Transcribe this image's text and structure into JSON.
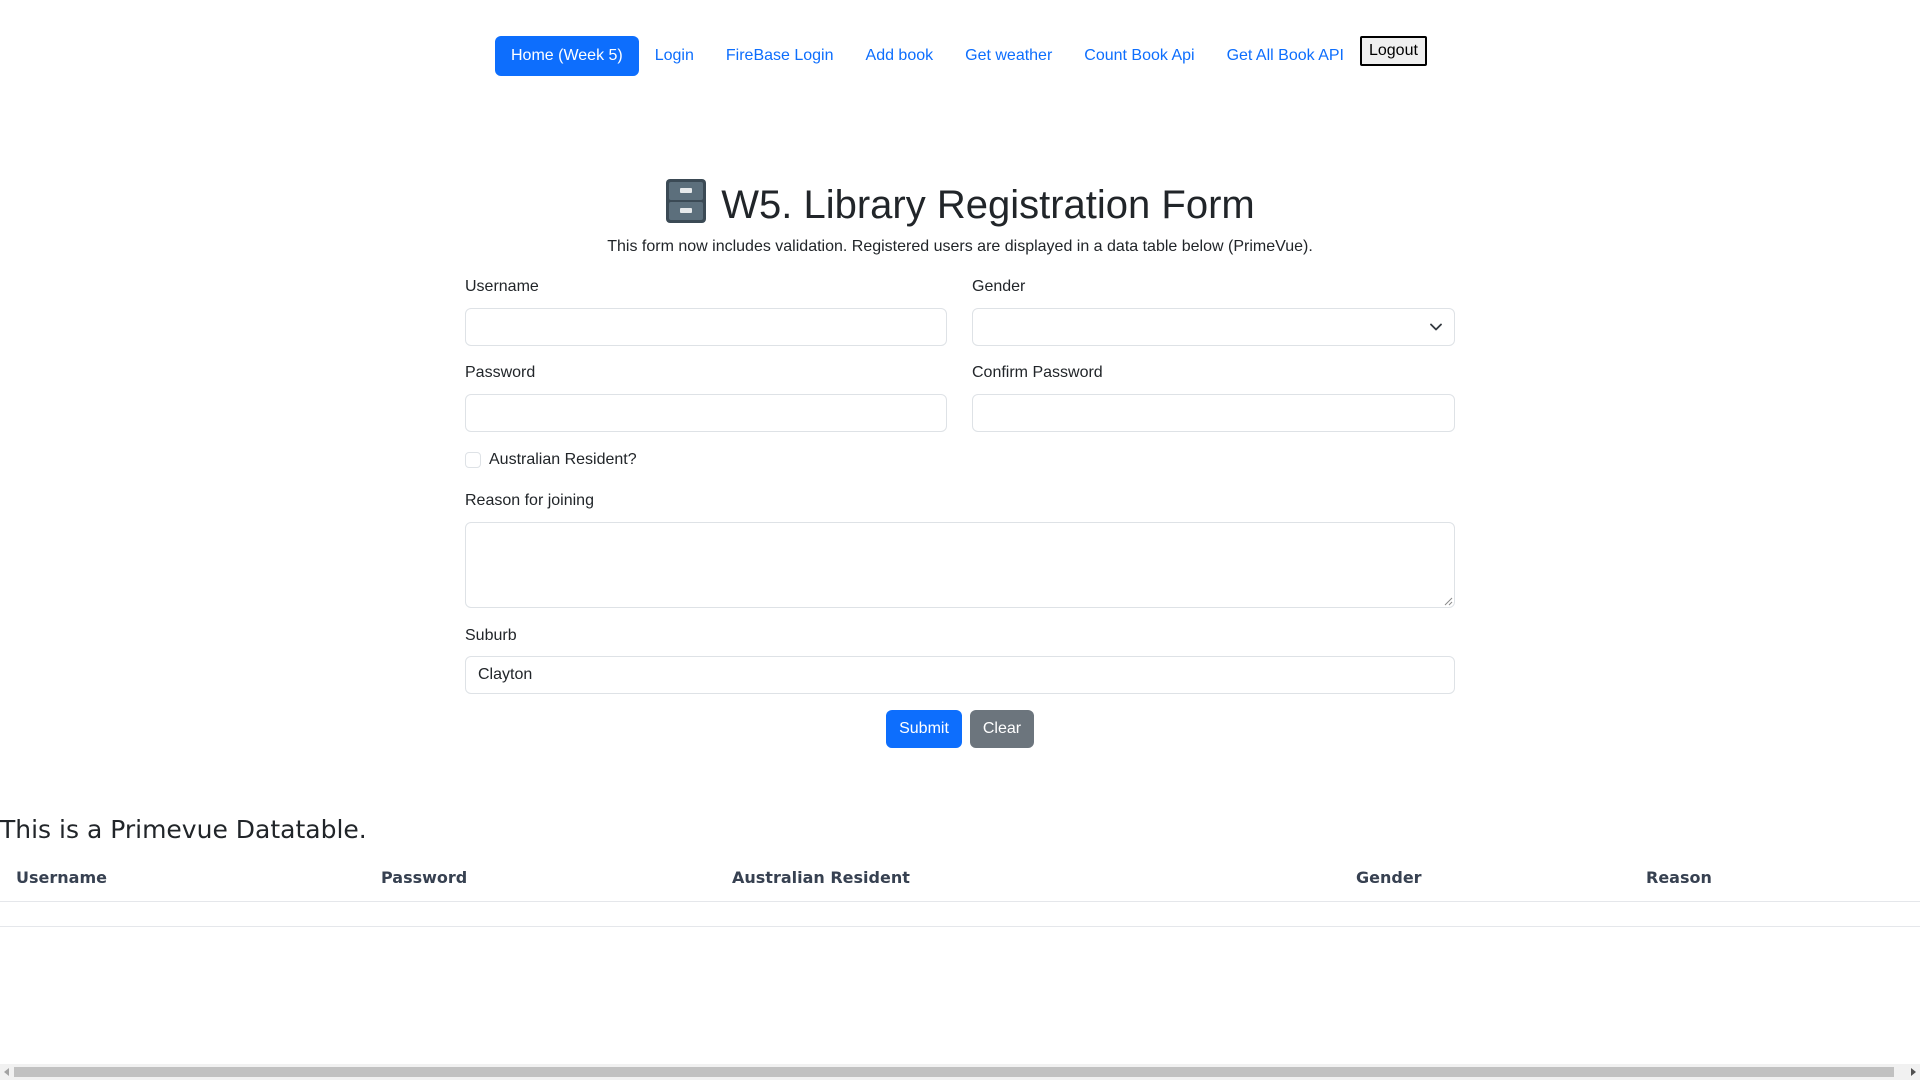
{
  "nav": {
    "items": [
      {
        "label": "Home (Week 5)"
      },
      {
        "label": "Login"
      },
      {
        "label": "FireBase Login"
      },
      {
        "label": "Add book"
      },
      {
        "label": "Get weather"
      },
      {
        "label": "Count Book Api"
      },
      {
        "label": "Get All Book API"
      }
    ],
    "logout_label": "Logout"
  },
  "form": {
    "title": "W5. Library Registration Form",
    "title_icon": "file-cabinet-icon",
    "subtitle": "This form now includes validation. Registered users are displayed in a data table below (PrimeVue).",
    "username_label": "Username",
    "username_value": "",
    "gender_label": "Gender",
    "gender_value": "",
    "password_label": "Password",
    "password_value": "",
    "confirm_password_label": "Confirm Password",
    "confirm_password_value": "",
    "resident_label": "Australian Resident?",
    "resident_checked": false,
    "reason_label": "Reason for joining",
    "reason_value": "",
    "suburb_label": "Suburb",
    "suburb_value": "Clayton",
    "submit_label": "Submit",
    "clear_label": "Clear"
  },
  "table": {
    "title": "This is a Primevue Datatable.",
    "columns": [
      "Username",
      "Password",
      "Australian Resident",
      "Gender",
      "Reason"
    ],
    "rows": []
  },
  "colors": {
    "primary": "#0d6efd",
    "secondary": "#6c757d",
    "text": "#212529",
    "border": "#dee2e6"
  }
}
